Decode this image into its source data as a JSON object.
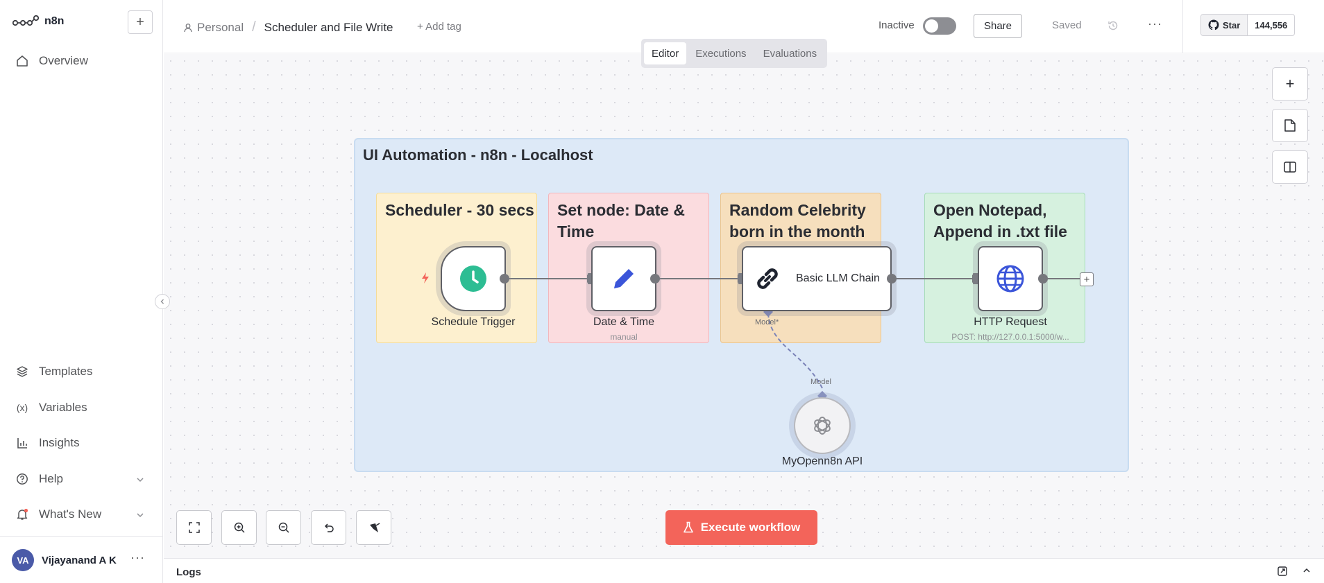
{
  "app": {
    "name": "n8n",
    "new_label": "+"
  },
  "sidebar": {
    "overview": "Overview",
    "items": [
      {
        "label": "Templates",
        "icon": "cube-icon"
      },
      {
        "label": "Variables",
        "icon": "variable-icon"
      },
      {
        "label": "Insights",
        "icon": "chart-icon"
      },
      {
        "label": "Help",
        "icon": "help-icon"
      },
      {
        "label": "What's New",
        "icon": "bell-icon"
      }
    ],
    "user": {
      "initials": "VA",
      "name": "Vijayanand A K"
    }
  },
  "header": {
    "project": "Personal",
    "workflow_name": "Scheduler and File Write",
    "add_tag": "+ Add tag",
    "status": "Inactive",
    "share": "Share",
    "saved": "Saved",
    "github_star": "Star",
    "github_count": "144,556"
  },
  "tabs": [
    {
      "label": "Editor",
      "active": true
    },
    {
      "label": "Executions",
      "active": false
    },
    {
      "label": "Evaluations",
      "active": false
    }
  ],
  "canvas": {
    "group_title": "UI Automation - n8n - Localhost",
    "stickies": [
      {
        "title": "Scheduler - 30 secs",
        "color": "#fdf0cf"
      },
      {
        "title": "Set node: Date & Time",
        "color": "#fbdcdf"
      },
      {
        "title": "Random Celebrity born in the month",
        "color": "#f6dfbd"
      },
      {
        "title": "Open Notepad, Append in .txt file",
        "color": "#d6f1df"
      }
    ],
    "nodes": {
      "schedule": {
        "label": "Schedule Trigger",
        "icon": "clock-icon"
      },
      "datetime": {
        "label": "Date & Time",
        "sub": "manual",
        "icon": "pencil-icon"
      },
      "llm": {
        "label": "Basic LLM Chain",
        "icon": "link-icon"
      },
      "http": {
        "label": "HTTP Request",
        "sub": "POST: http://127.0.0.1:5000/w...",
        "icon": "globe-icon"
      },
      "openai": {
        "label": "MyOpenn8n API",
        "icon": "openai-icon"
      }
    },
    "model_label_top": "Model*",
    "model_label_bottom": "Model"
  },
  "execute_label": "Execute workflow",
  "logs_label": "Logs",
  "colors": {
    "accent": "#f3645a",
    "group_bg": "#dde9f7"
  }
}
